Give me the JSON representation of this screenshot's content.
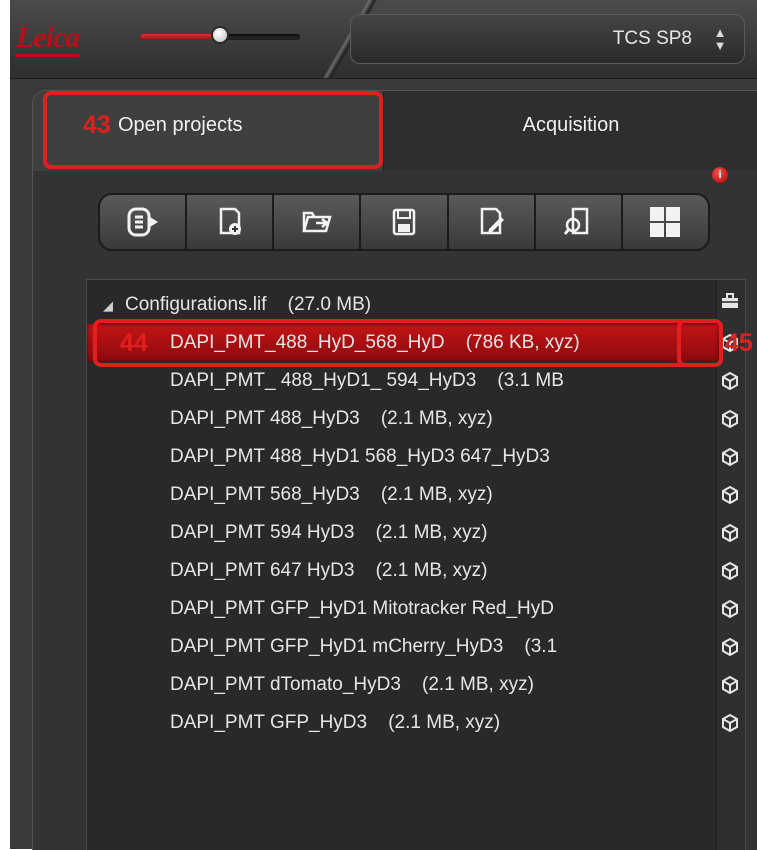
{
  "header": {
    "logo_text": "Leica",
    "slider_value": 0.5,
    "microscope": "TCS SP8"
  },
  "tabs": [
    {
      "label": "Open projects",
      "active": true
    },
    {
      "label": "Acquisition",
      "active": false
    }
  ],
  "annotations": {
    "open_projects_marker": "43",
    "selected_row_marker": "44",
    "cube_marker": "45",
    "color": "#e0201f"
  },
  "notification_badge": "i",
  "toolbar": {
    "buttons": [
      {
        "icon": "list-export-icon"
      },
      {
        "icon": "new-project-icon"
      },
      {
        "icon": "open-folder-icon"
      },
      {
        "icon": "save-icon"
      },
      {
        "icon": "edit-document-icon"
      },
      {
        "icon": "find-document-icon"
      },
      {
        "icon": "layout-grid-icon"
      }
    ]
  },
  "project": {
    "file_name": "Configurations.lif",
    "file_size": "(27.0 MB)",
    "items": [
      {
        "name": "DAPI_PMT_488_HyD_568_HyD",
        "info": "(786 KB, xyz)",
        "selected": true
      },
      {
        "name": "DAPI_PMT_ 488_HyD1_ 594_HyD3",
        "info": "(3.1 MB",
        "selected": false
      },
      {
        "name": "DAPI_PMT 488_HyD3",
        "info": "(2.1 MB, xyz)",
        "selected": false
      },
      {
        "name": "DAPI_PMT 488_HyD1 568_HyD3 647_HyD3",
        "info": "",
        "selected": false
      },
      {
        "name": "DAPI_PMT 568_HyD3",
        "info": "(2.1 MB, xyz)",
        "selected": false
      },
      {
        "name": "DAPI_PMT 594 HyD3",
        "info": "(2.1 MB, xyz)",
        "selected": false
      },
      {
        "name": "DAPI_PMT 647 HyD3",
        "info": "(2.1 MB, xyz)",
        "selected": false
      },
      {
        "name": "DAPI_PMT  GFP_HyD1  Mitotracker Red_HyD",
        "info": "",
        "selected": false
      },
      {
        "name": "DAPI_PMT GFP_HyD1 mCherry_HyD3",
        "info": "(3.1",
        "selected": false
      },
      {
        "name": "DAPI_PMT dTomato_HyD3",
        "info": "(2.1 MB, xyz)",
        "selected": false
      },
      {
        "name": "DAPI_PMT GFP_HyD3",
        "info": "(2.1 MB, xyz)",
        "selected": false
      }
    ]
  }
}
